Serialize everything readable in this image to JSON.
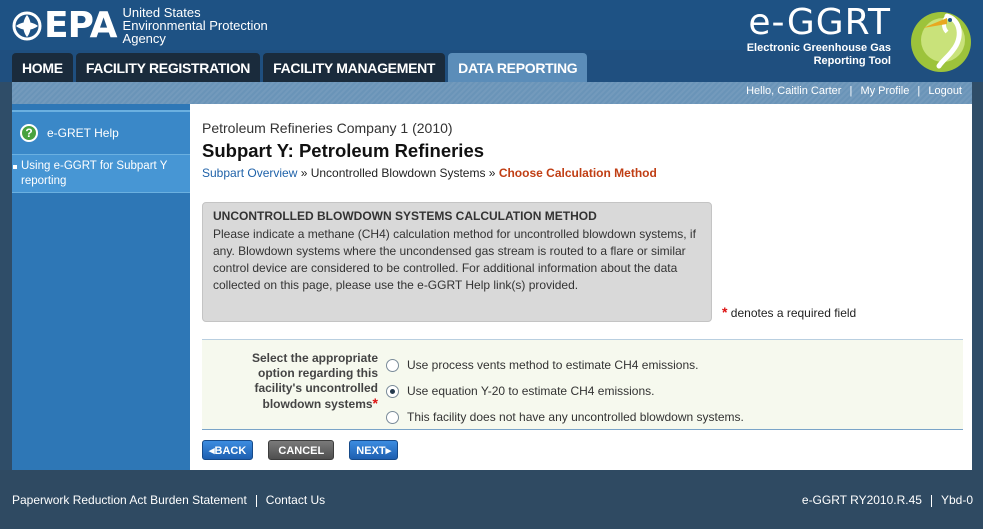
{
  "header": {
    "epa_mark": "EPA",
    "epa_lines": [
      "United States",
      "Environmental Protection",
      "Agency"
    ],
    "app_name": "e-GGRT",
    "app_sub": [
      "Electronic Greenhouse Gas",
      "Reporting Tool"
    ]
  },
  "tabs": [
    {
      "label": "HOME"
    },
    {
      "label": "FACILITY REGISTRATION"
    },
    {
      "label": "FACILITY MANAGEMENT"
    },
    {
      "label": "DATA REPORTING",
      "active": true
    }
  ],
  "userbar": {
    "greeting": "Hello, Caitlin Carter",
    "my_profile": "My Profile",
    "logout": "Logout",
    "separator": "|"
  },
  "sidebar": {
    "help_title": "e-GRET Help",
    "help_icon": "?",
    "link": "Using e-GGRT for Subpart Y reporting"
  },
  "main": {
    "company": "Petroleum Refineries Company 1 (2010)",
    "title": "Subpart Y: Petroleum Refineries",
    "breadcrumb": {
      "overview": "Subpart Overview",
      "sep1": " » ",
      "middle": "Uncontrolled Blowdown Systems",
      "sep2": " » ",
      "current": "Choose Calculation Method"
    },
    "info": {
      "title": "UNCONTROLLED BLOWDOWN SYSTEMS CALCULATION METHOD",
      "body": "Please indicate a methane (CH4) calculation method for uncontrolled blowdown systems, if any. Blowdown systems where the uncondensed gas stream is routed to a flare or similar control device are considered to be controlled. For additional information about the data collected on this page, please use the e-GGRT Help link(s) provided."
    },
    "required_note": "denotes a required field",
    "required_star": "*",
    "question": "Select the appropriate option regarding this facility's uncontrolled blowdown systems",
    "options": [
      {
        "label": "Use process vents method to estimate CH4 emissions.",
        "checked": false
      },
      {
        "label": "Use equation Y-20 to estimate CH4 emissions.",
        "checked": true
      },
      {
        "label": "This facility does not have any uncontrolled blowdown systems.",
        "checked": false
      }
    ],
    "buttons": {
      "back": "◂BACK",
      "cancel": "CANCEL",
      "next": "NEXT▸"
    }
  },
  "footer": {
    "paperwork": "Paperwork Reduction Act Burden Statement",
    "contact": "Contact Us",
    "version": "e-GGRT RY2010.R.45",
    "build": "Ybd-0"
  },
  "colors": {
    "header_blue": "#1e5284",
    "active_tab": "#5b8db9",
    "sidebar_blue": "#2e77b6",
    "breadcrumb_current": "#c03e14",
    "link_blue": "#1f62a9"
  }
}
